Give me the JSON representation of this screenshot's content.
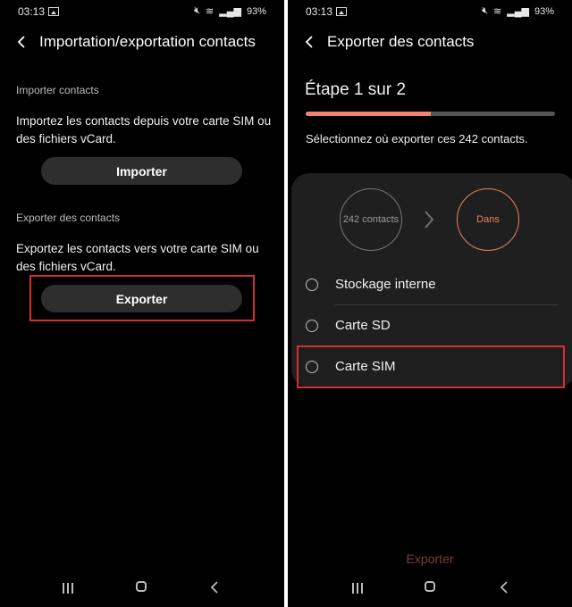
{
  "left": {
    "status": {
      "time": "03:13",
      "battery": "93%"
    },
    "title": "Importation/exportation contacts",
    "import_section": {
      "label": "Importer contacts",
      "description": "Importez les contacts depuis votre carte SIM ou des fichiers vCard.",
      "button": "Importer"
    },
    "export_section": {
      "label": "Exporter des contacts",
      "description": "Exportez les contacts vers votre carte SIM ou des fichiers vCard.",
      "button": "Exporter"
    }
  },
  "right": {
    "status": {
      "time": "03:13",
      "battery": "93%"
    },
    "title": "Exporter des contacts",
    "step": "Étape 1 sur 2",
    "progress": 0.5,
    "instruction": "Sélectionnez où exporter ces 242 contacts.",
    "from_label": "242 contacts",
    "to_label": "Dans",
    "options": [
      "Stockage interne",
      "Carte SD",
      "Carte SIM"
    ],
    "action": "Exporter"
  },
  "colors": {
    "accent": "#ee8063",
    "highlight": "#d32f2f",
    "background": "#000000"
  }
}
